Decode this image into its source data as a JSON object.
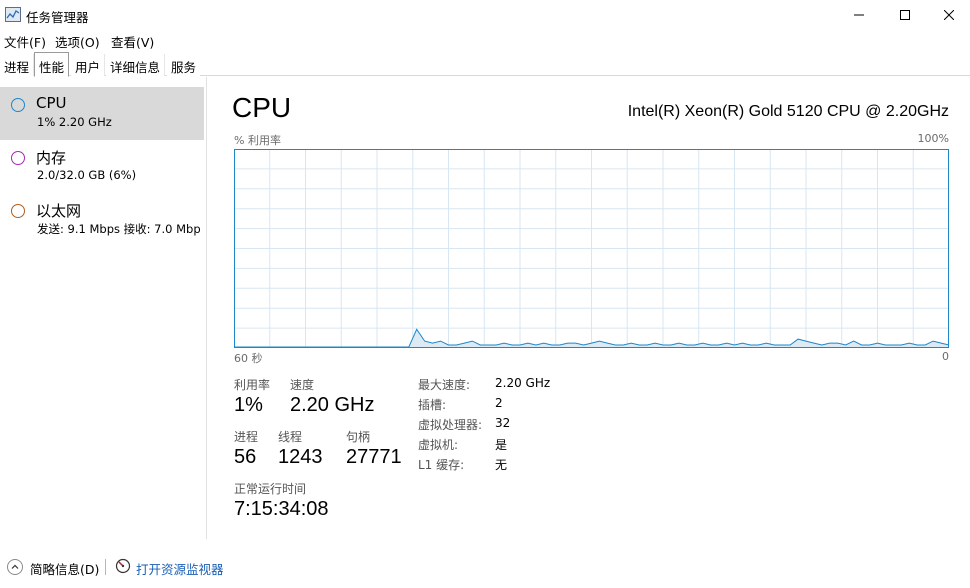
{
  "window": {
    "title": "任务管理器"
  },
  "menu": {
    "file": "文件(F)",
    "options": "选项(O)",
    "view": "查看(V)"
  },
  "tabs": [
    "进程",
    "性能",
    "用户",
    "详细信息",
    "服务"
  ],
  "active_tab": "性能",
  "sidebar": {
    "items": [
      {
        "name": "CPU",
        "sub": "1%  2.20 GHz",
        "color": "#1e87c9",
        "selected": true
      },
      {
        "name": "内存",
        "sub": "2.0/32.0 GB (6%)",
        "color": "#a32bb2",
        "selected": false
      },
      {
        "name": "以太网",
        "sub": "发送: 9.1 Mbps  接收: 7.0 Mbp",
        "color": "#b45c1e",
        "selected": false
      }
    ]
  },
  "main": {
    "title": "CPU",
    "model": "Intel(R) Xeon(R) Gold 5120 CPU @ 2.20GHz",
    "util_label": "% 利用率",
    "util_max": "100%",
    "time_left": "60 秒",
    "time_right": "0",
    "graph_color": "#1e87c9",
    "graph_fill": "#dbeaf5",
    "graph_samples": [
      0,
      0,
      0,
      0,
      0,
      0,
      0,
      0,
      0,
      0,
      0,
      0,
      0,
      0,
      0,
      0,
      0,
      0,
      0,
      0,
      0,
      0,
      0,
      9,
      3,
      2,
      3,
      1,
      1,
      2,
      3,
      1,
      1,
      1,
      2,
      1,
      1,
      2,
      1,
      2,
      1,
      1,
      2,
      2,
      1,
      2,
      3,
      2,
      1,
      1,
      2,
      1,
      1,
      2,
      1,
      1,
      2,
      1,
      1,
      2,
      1,
      1,
      2,
      1,
      2,
      1,
      1,
      2,
      1,
      1,
      1,
      4,
      3,
      2,
      1,
      2,
      2,
      1,
      3,
      1,
      1,
      2,
      1,
      1,
      1,
      2,
      1,
      1,
      3,
      2,
      1
    ]
  },
  "stats": {
    "util_label": "利用率",
    "util_value": "1%",
    "speed_label": "速度",
    "speed_value": "2.20 GHz",
    "proc_label": "进程",
    "proc_value": "56",
    "threads_label": "线程",
    "threads_value": "1243",
    "handles_label": "句柄",
    "handles_value": "27771",
    "uptime_label": "正常运行时间",
    "uptime_value": "7:15:34:08"
  },
  "specs": [
    {
      "label": "最大速度:",
      "value": "2.20 GHz"
    },
    {
      "label": "插槽:",
      "value": "2"
    },
    {
      "label": "虚拟处理器:",
      "value": "32"
    },
    {
      "label": "虚拟机:",
      "value": "是"
    },
    {
      "label": "L1 缓存:",
      "value": "无"
    }
  ],
  "footer": {
    "fewer_details": "简略信息(D)",
    "open_resmon": "打开资源监视器"
  }
}
